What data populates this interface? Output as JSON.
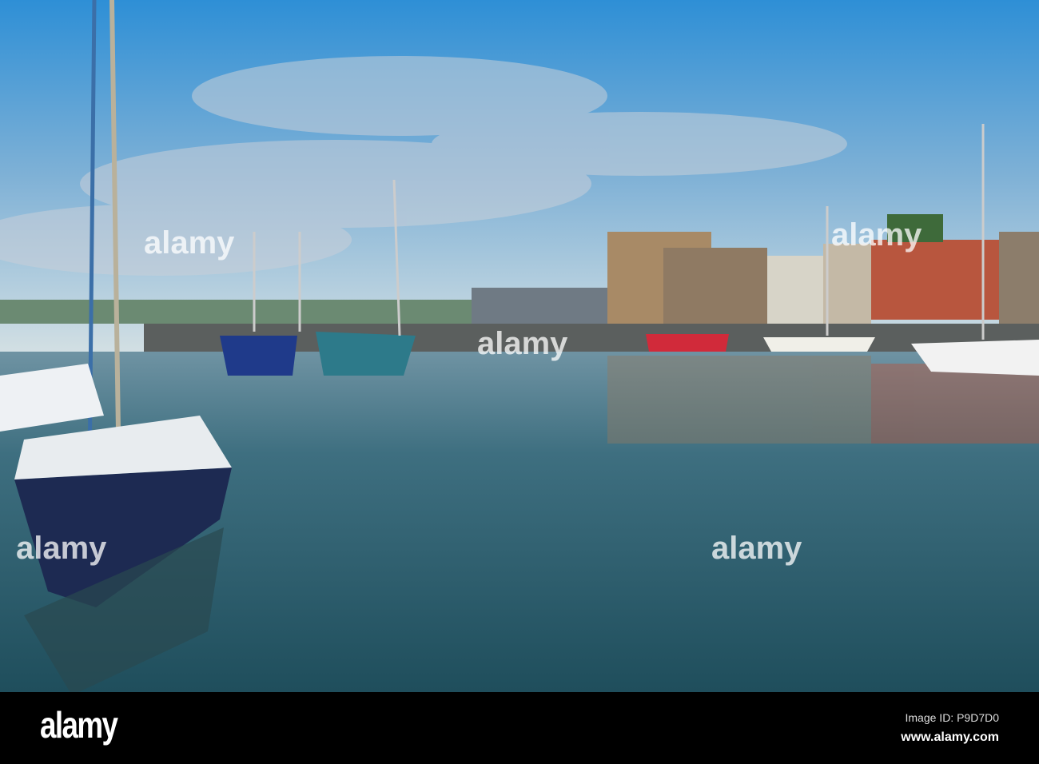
{
  "footer": {
    "logo": "alamy",
    "image_id": "Image ID: P9D7D0",
    "url": "www.alamy.com"
  },
  "watermark": "alamy",
  "colors": {
    "sky_top": "#2e8fd6",
    "sky_horizon": "#c9dbe4",
    "water": "#2f5d6c",
    "footer": "#000000"
  }
}
